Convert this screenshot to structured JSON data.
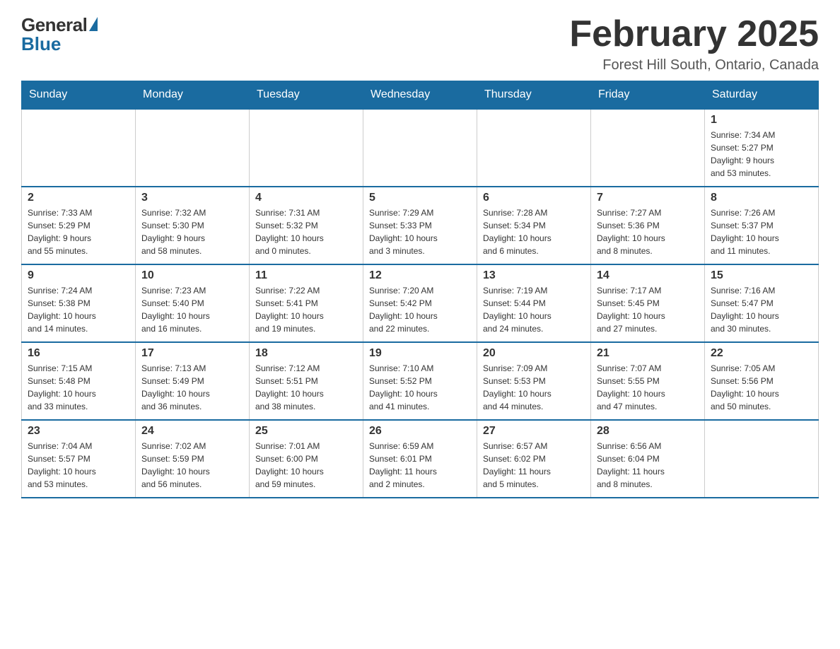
{
  "logo": {
    "general": "General",
    "blue": "Blue"
  },
  "title": "February 2025",
  "location": "Forest Hill South, Ontario, Canada",
  "days_of_week": [
    "Sunday",
    "Monday",
    "Tuesday",
    "Wednesday",
    "Thursday",
    "Friday",
    "Saturday"
  ],
  "weeks": [
    [
      {
        "day": "",
        "info": ""
      },
      {
        "day": "",
        "info": ""
      },
      {
        "day": "",
        "info": ""
      },
      {
        "day": "",
        "info": ""
      },
      {
        "day": "",
        "info": ""
      },
      {
        "day": "",
        "info": ""
      },
      {
        "day": "1",
        "info": "Sunrise: 7:34 AM\nSunset: 5:27 PM\nDaylight: 9 hours\nand 53 minutes."
      }
    ],
    [
      {
        "day": "2",
        "info": "Sunrise: 7:33 AM\nSunset: 5:29 PM\nDaylight: 9 hours\nand 55 minutes."
      },
      {
        "day": "3",
        "info": "Sunrise: 7:32 AM\nSunset: 5:30 PM\nDaylight: 9 hours\nand 58 minutes."
      },
      {
        "day": "4",
        "info": "Sunrise: 7:31 AM\nSunset: 5:32 PM\nDaylight: 10 hours\nand 0 minutes."
      },
      {
        "day": "5",
        "info": "Sunrise: 7:29 AM\nSunset: 5:33 PM\nDaylight: 10 hours\nand 3 minutes."
      },
      {
        "day": "6",
        "info": "Sunrise: 7:28 AM\nSunset: 5:34 PM\nDaylight: 10 hours\nand 6 minutes."
      },
      {
        "day": "7",
        "info": "Sunrise: 7:27 AM\nSunset: 5:36 PM\nDaylight: 10 hours\nand 8 minutes."
      },
      {
        "day": "8",
        "info": "Sunrise: 7:26 AM\nSunset: 5:37 PM\nDaylight: 10 hours\nand 11 minutes."
      }
    ],
    [
      {
        "day": "9",
        "info": "Sunrise: 7:24 AM\nSunset: 5:38 PM\nDaylight: 10 hours\nand 14 minutes."
      },
      {
        "day": "10",
        "info": "Sunrise: 7:23 AM\nSunset: 5:40 PM\nDaylight: 10 hours\nand 16 minutes."
      },
      {
        "day": "11",
        "info": "Sunrise: 7:22 AM\nSunset: 5:41 PM\nDaylight: 10 hours\nand 19 minutes."
      },
      {
        "day": "12",
        "info": "Sunrise: 7:20 AM\nSunset: 5:42 PM\nDaylight: 10 hours\nand 22 minutes."
      },
      {
        "day": "13",
        "info": "Sunrise: 7:19 AM\nSunset: 5:44 PM\nDaylight: 10 hours\nand 24 minutes."
      },
      {
        "day": "14",
        "info": "Sunrise: 7:17 AM\nSunset: 5:45 PM\nDaylight: 10 hours\nand 27 minutes."
      },
      {
        "day": "15",
        "info": "Sunrise: 7:16 AM\nSunset: 5:47 PM\nDaylight: 10 hours\nand 30 minutes."
      }
    ],
    [
      {
        "day": "16",
        "info": "Sunrise: 7:15 AM\nSunset: 5:48 PM\nDaylight: 10 hours\nand 33 minutes."
      },
      {
        "day": "17",
        "info": "Sunrise: 7:13 AM\nSunset: 5:49 PM\nDaylight: 10 hours\nand 36 minutes."
      },
      {
        "day": "18",
        "info": "Sunrise: 7:12 AM\nSunset: 5:51 PM\nDaylight: 10 hours\nand 38 minutes."
      },
      {
        "day": "19",
        "info": "Sunrise: 7:10 AM\nSunset: 5:52 PM\nDaylight: 10 hours\nand 41 minutes."
      },
      {
        "day": "20",
        "info": "Sunrise: 7:09 AM\nSunset: 5:53 PM\nDaylight: 10 hours\nand 44 minutes."
      },
      {
        "day": "21",
        "info": "Sunrise: 7:07 AM\nSunset: 5:55 PM\nDaylight: 10 hours\nand 47 minutes."
      },
      {
        "day": "22",
        "info": "Sunrise: 7:05 AM\nSunset: 5:56 PM\nDaylight: 10 hours\nand 50 minutes."
      }
    ],
    [
      {
        "day": "23",
        "info": "Sunrise: 7:04 AM\nSunset: 5:57 PM\nDaylight: 10 hours\nand 53 minutes."
      },
      {
        "day": "24",
        "info": "Sunrise: 7:02 AM\nSunset: 5:59 PM\nDaylight: 10 hours\nand 56 minutes."
      },
      {
        "day": "25",
        "info": "Sunrise: 7:01 AM\nSunset: 6:00 PM\nDaylight: 10 hours\nand 59 minutes."
      },
      {
        "day": "26",
        "info": "Sunrise: 6:59 AM\nSunset: 6:01 PM\nDaylight: 11 hours\nand 2 minutes."
      },
      {
        "day": "27",
        "info": "Sunrise: 6:57 AM\nSunset: 6:02 PM\nDaylight: 11 hours\nand 5 minutes."
      },
      {
        "day": "28",
        "info": "Sunrise: 6:56 AM\nSunset: 6:04 PM\nDaylight: 11 hours\nand 8 minutes."
      },
      {
        "day": "",
        "info": ""
      }
    ]
  ]
}
